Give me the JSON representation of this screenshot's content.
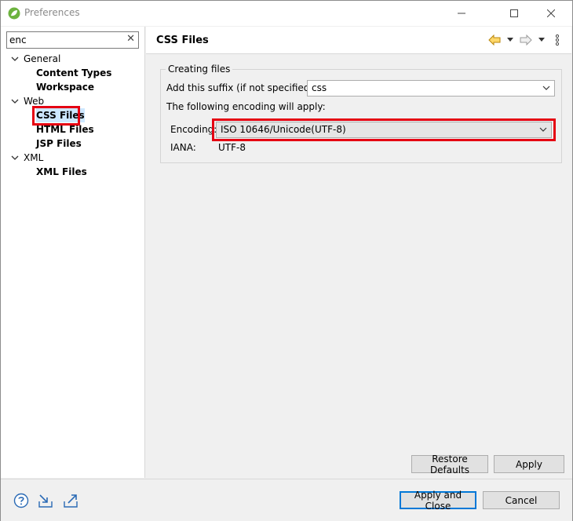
{
  "window": {
    "title": "Preferences"
  },
  "filter": {
    "value": "enc"
  },
  "tree": {
    "general": {
      "label": "General",
      "children": [
        "Content Types",
        "Workspace"
      ]
    },
    "web": {
      "label": "Web",
      "children": [
        "CSS Files",
        "HTML Files",
        "JSP Files"
      ]
    },
    "xml": {
      "label": "XML",
      "children": [
        "XML Files"
      ]
    }
  },
  "page": {
    "title": "CSS Files",
    "group_label": "Creating files",
    "suffix_label": "Add this suffix (if not specified):",
    "suffix_value": "css",
    "encoding_note": "The following encoding will apply:",
    "encoding_label": "Encoding:",
    "encoding_value": "ISO 10646/Unicode(UTF-8)",
    "iana_label": "IANA:",
    "iana_value": "UTF-8"
  },
  "buttons": {
    "restore_defaults": "Restore Defaults",
    "apply": "Apply",
    "apply_and_close": "Apply and Close",
    "cancel": "Cancel"
  },
  "colors": {
    "highlight": "#e50012",
    "selection": "#cde8ff",
    "accent": "#0078d7"
  }
}
